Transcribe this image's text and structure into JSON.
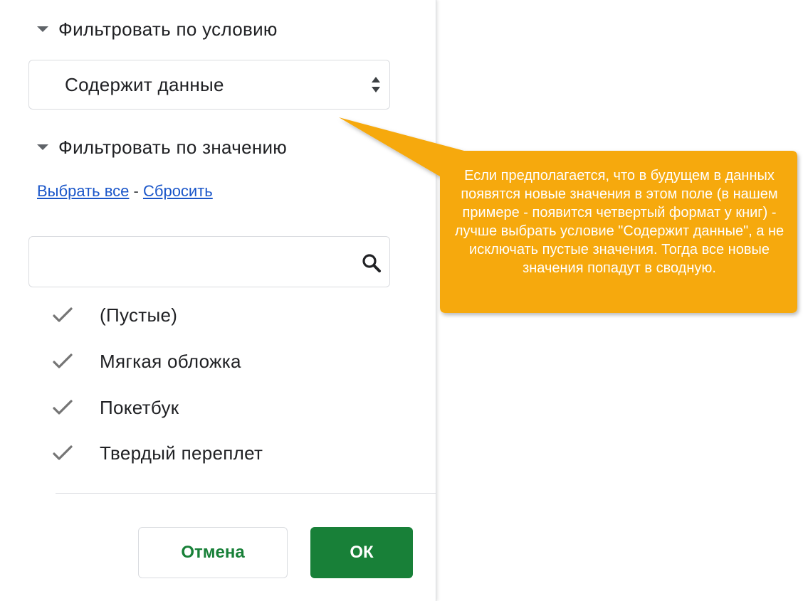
{
  "condition_section": {
    "title": "Фильтровать по условию",
    "selected_value": "Содержит данные"
  },
  "value_section": {
    "title": "Фильтровать по значению",
    "select_all_label": "Выбрать все",
    "separator": " - ",
    "reset_label": "Сбросить",
    "search": {
      "value": "",
      "placeholder": ""
    },
    "items": [
      {
        "label": "(Пустые)",
        "checked": true
      },
      {
        "label": "Мягкая обложка",
        "checked": true
      },
      {
        "label": "Покетбук",
        "checked": true
      },
      {
        "label": "Твердый переплет",
        "checked": true
      }
    ]
  },
  "buttons": {
    "cancel_label": "Отмена",
    "ok_label": "ОК"
  },
  "callout": {
    "text": "Если предполагается, что в будущем в данных появятся новые значения в этом поле (в нашем примере - появится четвертый формат у книг) - лучше выбрать условие \"Содержит данные\", а не исключать пустые значения. Тогда все новые значения попадут в сводную."
  },
  "colors": {
    "accent_green": "#188038",
    "link_blue": "#1a56c9",
    "callout_orange": "#f6a90c"
  },
  "icons": {
    "section_toggle": "caret-down-icon",
    "select_arrows": "updown-arrows-icon",
    "search": "search-icon",
    "item_check": "checkmark-icon"
  }
}
